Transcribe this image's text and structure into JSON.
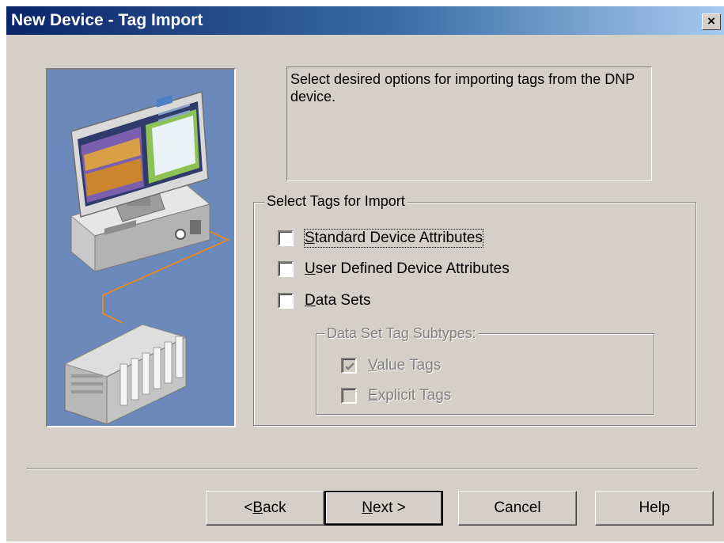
{
  "window": {
    "title": "New Device - Tag Import",
    "close_label": "×"
  },
  "description": "Select desired options for importing tags from the DNP device.",
  "tag_group": {
    "legend": "Select Tags for Import",
    "options": [
      {
        "pre": "",
        "accel": "S",
        "post": "tandard Device Attributes",
        "checked": false,
        "enabled": true
      },
      {
        "pre": "",
        "accel": "U",
        "post": "ser Defined Device Attributes",
        "checked": false,
        "enabled": true
      },
      {
        "pre": "",
        "accel": "D",
        "post": "ata Sets",
        "checked": false,
        "enabled": true
      }
    ]
  },
  "subtype_group": {
    "legend": "Data Set Tag Subtypes:",
    "options": [
      {
        "pre": "",
        "accel": "V",
        "post": "alue Tags",
        "checked": true,
        "enabled": false
      },
      {
        "pre": "",
        "accel": "E",
        "post": "xplicit Tags",
        "checked": false,
        "enabled": false
      }
    ]
  },
  "buttons": {
    "back": {
      "pre": "< ",
      "accel": "B",
      "post": "ack"
    },
    "next": {
      "pre": "",
      "accel": "N",
      "post": "ext >"
    },
    "cancel": "Cancel",
    "help": "Help"
  },
  "colors": {
    "title_gradient_start": "#0a246a",
    "title_gradient_end": "#a6caf0",
    "dialog_face": "#d4d0c8",
    "image_background": "#6b89bb"
  }
}
